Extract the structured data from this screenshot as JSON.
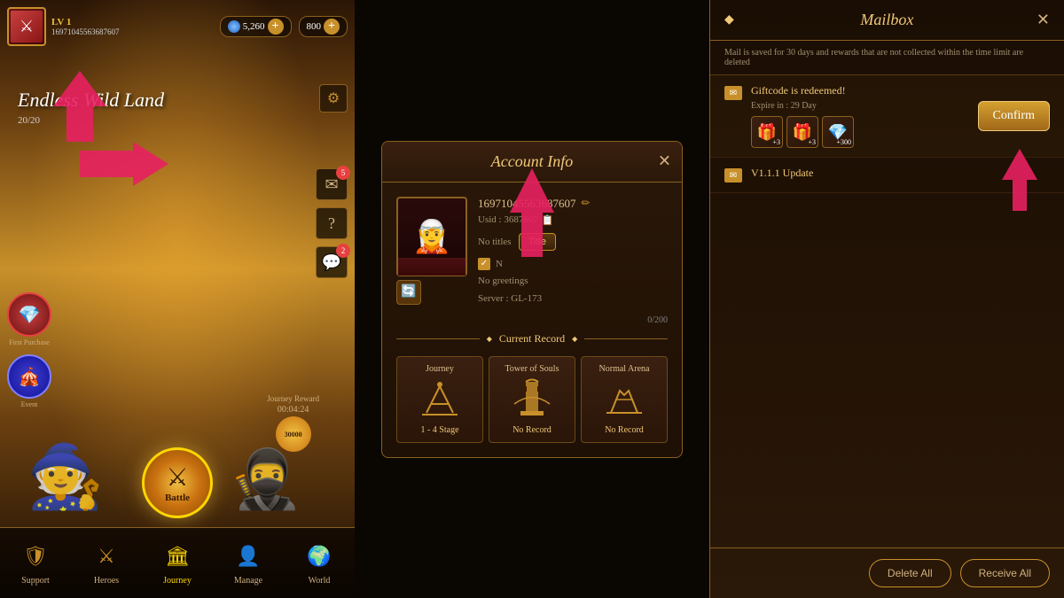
{
  "left": {
    "player": {
      "level": "LV 1",
      "uid": "16971045563687607",
      "currency1": "5,260",
      "currency2": "800",
      "map_name": "ndless Wild Land",
      "map_progress": "20"
    },
    "bottom_nav": [
      {
        "id": "support",
        "label": "Support",
        "icon": "🛡"
      },
      {
        "id": "heroes",
        "label": "Heroes",
        "icon": "⚔"
      },
      {
        "id": "journey",
        "label": "Journey",
        "icon": "🏛",
        "active": true
      },
      {
        "id": "manage",
        "label": "Manage",
        "icon": "👤"
      },
      {
        "id": "world",
        "label": "World",
        "icon": "🌍"
      }
    ],
    "battle_label": "Battle",
    "journey_reward_label": "Journey Reward",
    "journey_timer": "00:04:24",
    "journey_amount": "30000",
    "first_purchase_label": "First Purchase",
    "event_label": "Event",
    "mail_badge": "5",
    "bubble_badge": "2"
  },
  "middle": {
    "title": "Account Info",
    "uid": "16971045563687607",
    "usid_label": "Usid : 3687607",
    "no_title": "No titles",
    "title_btn": "Title",
    "no_greeting": "No greetings",
    "server": "Server : GL-173",
    "char_count": "0/200",
    "current_record_label": "Current Record",
    "records": [
      {
        "title": "Journey",
        "icon": "⚔",
        "value": "1 - 4 Stage"
      },
      {
        "title": "Tower of Souls",
        "icon": "🏛",
        "value": "No Record"
      },
      {
        "title": "Normal Arena",
        "icon": "⚔",
        "value": "No Record"
      }
    ]
  },
  "right": {
    "title": "Mailbox",
    "subtitle": "Mail is saved for 30 days and rewards that are not collected within the time limit are deleted",
    "mails": [
      {
        "subject": "Giftcode is redeemed!",
        "expire": "Expire in : 29 Day",
        "has_rewards": true,
        "rewards": [
          "🎁",
          "🎁",
          "💎"
        ],
        "reward_counts": [
          "+3",
          "+3",
          "+300"
        ],
        "confirm_btn": "Confirm"
      },
      {
        "subject": "V1.1.1 Update",
        "expire": "",
        "has_rewards": false
      }
    ],
    "confirm_btn": "Confirm",
    "delete_all_btn": "Delete All",
    "receive_all_btn": "Receive All"
  }
}
